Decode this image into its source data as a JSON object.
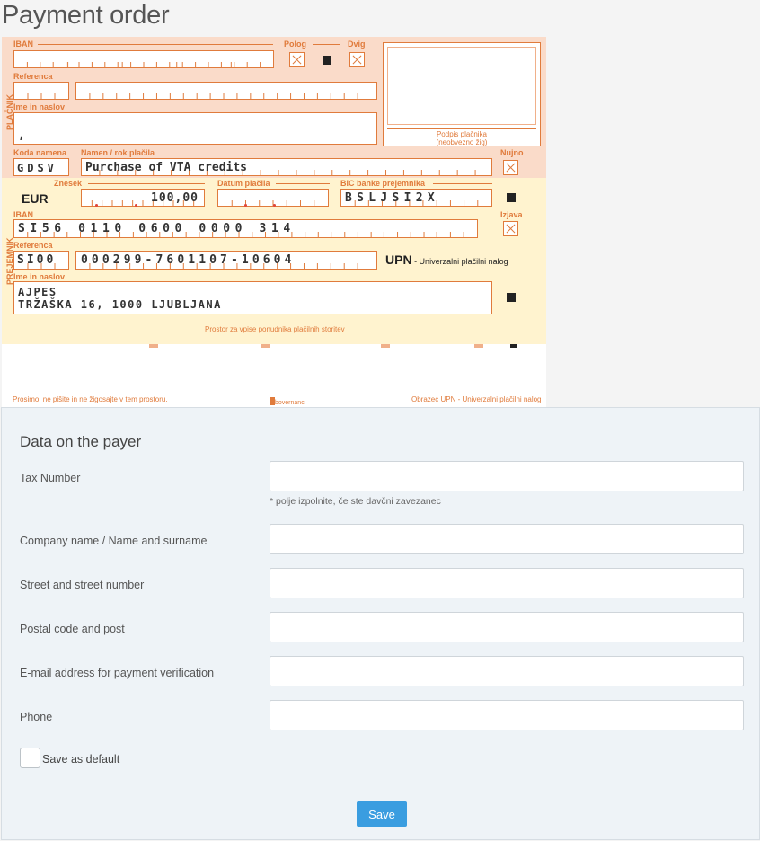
{
  "page": {
    "title": "Payment order"
  },
  "slip": {
    "labels": {
      "iban": "IBAN",
      "polog": "Polog",
      "dvig": "Dvig",
      "referenca": "Referenca",
      "ime_naslov": "Ime in naslov",
      "placnik": "PLAČNIK",
      "koda_namena": "Koda namena",
      "namen_rok": "Namen / rok plačila",
      "nujno": "Nujno",
      "znesek": "Znesek",
      "datum": "Datum plačila",
      "bic": "BIC banke prejemnika",
      "izjava": "Izjava",
      "prejemnik": "PREJEMNIK",
      "currency": "EUR",
      "podpis": "Podpis plačnika",
      "zig": "(neobvezno žig)",
      "upn": "UPN",
      "upn_sub": " - Univerzalni plačilni nalog",
      "prostor": "Prostor za vpise ponudnika plačilnih storitev",
      "prosimo": "Prosimo, ne pišite in ne žigosajte v tem prostoru.",
      "obrazec": "Obrazec UPN - Univerzalni plačilni nalog",
      "logo": "bovernanc"
    },
    "values": {
      "payer_name": ",",
      "purpose_code": "GDSV",
      "purpose": "Purchase of VTA credits",
      "amount": "100,00",
      "bic": "BSLJSI2X",
      "receiver_iban": "SI56 0110 0600 0000 314",
      "model": "SI00",
      "reference": "000299-7601107-10604",
      "receiver_name": "AJPES",
      "receiver_address": "TRŽAŠKA 16, 1000 LJUBLJANA"
    }
  },
  "form": {
    "heading": "Data on the payer",
    "fields": [
      {
        "label": "Tax Number",
        "value": ""
      },
      {
        "label": "Company name / Name and surname",
        "value": ""
      },
      {
        "label": "Street and street number",
        "value": ""
      },
      {
        "label": "Postal code and post",
        "value": ""
      },
      {
        "label": "E-mail address for payment verification",
        "value": ""
      },
      {
        "label": "Phone",
        "value": ""
      }
    ],
    "tax_note": "* polje izpolnite, če ste davčni zavezanec",
    "save_default_label": "Save as default",
    "save_default_checked": false,
    "save_button": "Save"
  },
  "colors": {
    "accent": "#e07b3c",
    "payer_bg": "#fadbc9",
    "receiver_bg": "#fff3cf",
    "button": "#3a9de0"
  }
}
